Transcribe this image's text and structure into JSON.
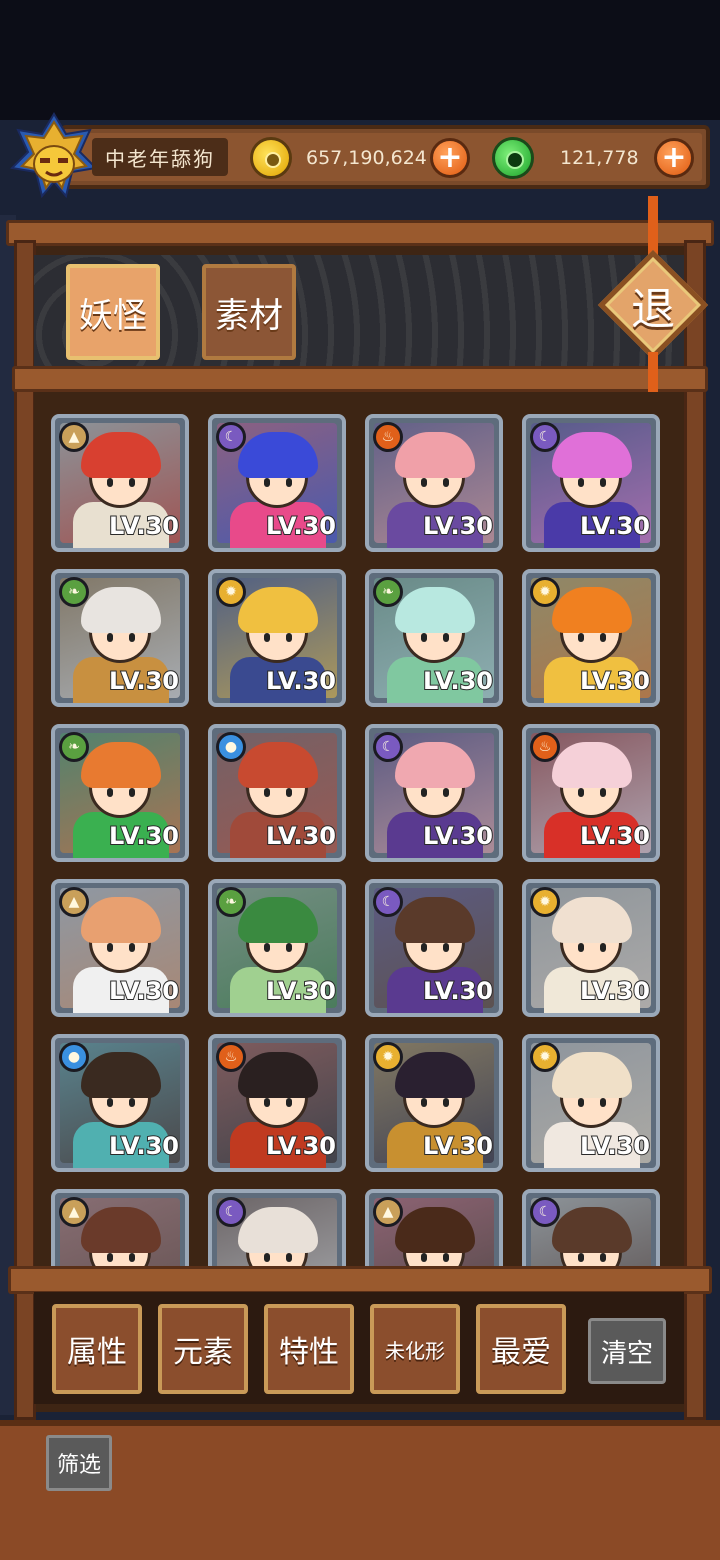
{
  "hud": {
    "player_name": "中老年舔狗",
    "gold": "657,190,624",
    "jade": "121,778",
    "plus_symbol": "+"
  },
  "tabs": {
    "yokai": "妖怪",
    "material": "素材"
  },
  "exit_label": "退",
  "cards": [
    {
      "level": "LV.30",
      "element": "earth",
      "elem_color": "#c9a05a",
      "elem_glyph": "▲",
      "hair": "#d84030",
      "body": "#e8e0d0"
    },
    {
      "level": "LV.30",
      "element": "moon",
      "elem_color": "#7a5ac0",
      "elem_glyph": "☾",
      "hair": "#3a4ad8",
      "body": "#e84a8a"
    },
    {
      "level": "LV.30",
      "element": "fire",
      "elem_color": "#e0601a",
      "elem_glyph": "♨",
      "hair": "#f0a0a8",
      "body": "#6a4aa0"
    },
    {
      "level": "LV.30",
      "element": "moon",
      "elem_color": "#7a5ac0",
      "elem_glyph": "☾",
      "hair": "#e070d8",
      "body": "#4a3aa8"
    },
    {
      "level": "LV.30",
      "element": "wood",
      "elem_color": "#5aa040",
      "elem_glyph": "❧",
      "hair": "#e8e4e0",
      "body": "#c89040"
    },
    {
      "level": "LV.30",
      "element": "sun",
      "elem_color": "#e8b030",
      "elem_glyph": "✹",
      "hair": "#f0c040",
      "body": "#3a4a90"
    },
    {
      "level": "LV.30",
      "element": "wood",
      "elem_color": "#5aa040",
      "elem_glyph": "❧",
      "hair": "#b8e8e0",
      "body": "#80c8a0"
    },
    {
      "level": "LV.30",
      "element": "sun",
      "elem_color": "#e8b030",
      "elem_glyph": "✹",
      "hair": "#f08020",
      "body": "#f0c040"
    },
    {
      "level": "LV.30",
      "element": "wood",
      "elem_color": "#5aa040",
      "elem_glyph": "❧",
      "hair": "#e87a30",
      "body": "#3ab050"
    },
    {
      "level": "LV.30",
      "element": "water",
      "elem_color": "#3a90e0",
      "elem_glyph": "●",
      "hair": "#c84a30",
      "body": "#a04a3a"
    },
    {
      "level": "LV.30",
      "element": "moon",
      "elem_color": "#7a5ac0",
      "elem_glyph": "☾",
      "hair": "#f0a8b0",
      "body": "#5a3a90"
    },
    {
      "level": "LV.30",
      "element": "fire",
      "elem_color": "#e0601a",
      "elem_glyph": "♨",
      "hair": "#f5d0d8",
      "body": "#d83028"
    },
    {
      "level": "LV.30",
      "element": "earth",
      "elem_color": "#c9a05a",
      "elem_glyph": "▲",
      "hair": "#e8a070",
      "body": "#f0f0f0"
    },
    {
      "level": "LV.30",
      "element": "wood",
      "elem_color": "#5aa040",
      "elem_glyph": "❧",
      "hair": "#3a8a40",
      "body": "#a0d090"
    },
    {
      "level": "LV.30",
      "element": "moon",
      "elem_color": "#7a5ac0",
      "elem_glyph": "☾",
      "hair": "#5a3a2a",
      "body": "#5a3a90"
    },
    {
      "level": "LV.30",
      "element": "sun",
      "elem_color": "#e8b030",
      "elem_glyph": "✹",
      "hair": "#f0e0d0",
      "body": "#f0e8d8"
    },
    {
      "level": "LV.30",
      "element": "water",
      "elem_color": "#3a90e0",
      "elem_glyph": "●",
      "hair": "#3a2a20",
      "body": "#50b0b0"
    },
    {
      "level": "LV.30",
      "element": "fire",
      "elem_color": "#e0601a",
      "elem_glyph": "♨",
      "hair": "#2a2020",
      "body": "#c03a20"
    },
    {
      "level": "LV.30",
      "element": "sun",
      "elem_color": "#e8b030",
      "elem_glyph": "✹",
      "hair": "#2a2030",
      "body": "#c89030"
    },
    {
      "level": "LV.30",
      "element": "sun",
      "elem_color": "#e8b030",
      "elem_glyph": "✹",
      "hair": "#f0e0c8",
      "body": "#f0e8e0"
    },
    {
      "level": "",
      "element": "earth",
      "elem_color": "#c9a05a",
      "elem_glyph": "▲",
      "hair": "#6a3a2a",
      "body": "#d87060"
    },
    {
      "level": "",
      "element": "moon",
      "elem_color": "#7a5ac0",
      "elem_glyph": "☾",
      "hair": "#e8e0d8",
      "body": "#8a5a40"
    },
    {
      "level": "",
      "element": "earth",
      "elem_color": "#c9a05a",
      "elem_glyph": "▲",
      "hair": "#4a2a1a",
      "body": "#e85060"
    },
    {
      "level": "",
      "element": "moon",
      "elem_color": "#7a5ac0",
      "elem_glyph": "☾",
      "hair": "#5a3a2a",
      "body": "#e8e0d0"
    }
  ],
  "filters": {
    "attribute": "属性",
    "element": "元素",
    "trait": "特性",
    "untransformed": "未化形",
    "favorite": "最爱",
    "clear": "清空"
  },
  "screen_label": "筛选",
  "colors": {
    "wood_frame": "#9a5a2e",
    "panel_dark": "#3d2514",
    "accent_orange": "#e0601a"
  }
}
